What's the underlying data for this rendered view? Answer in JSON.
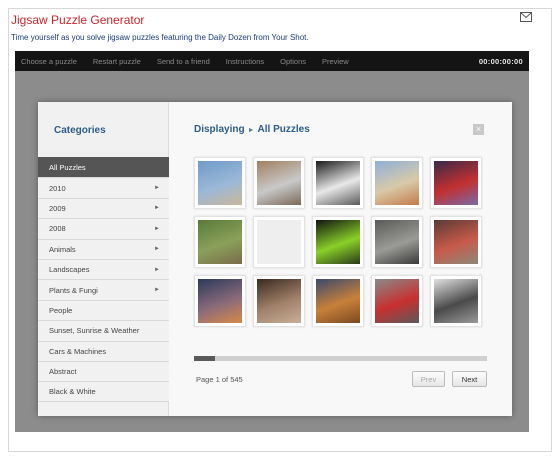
{
  "app": {
    "title": "Jigsaw Puzzle Generator",
    "tagline": "Time yourself as you solve jigsaw puzzles featuring the Daily Dozen from Your Shot.",
    "email_icon": "envelope-icon"
  },
  "toolbar": {
    "items": [
      "Choose a puzzle",
      "Restart puzzle",
      "Send to a friend",
      "Instructions",
      "Options",
      "Preview"
    ],
    "timer": "00:00:00:00"
  },
  "sidebar": {
    "title": "Categories",
    "items": [
      {
        "label": "All Puzzles",
        "has_submenu": false,
        "active": true
      },
      {
        "label": "2010",
        "has_submenu": true
      },
      {
        "label": "2009",
        "has_submenu": true
      },
      {
        "label": "2008",
        "has_submenu": true
      },
      {
        "label": "Animals",
        "has_submenu": true
      },
      {
        "label": "Landscapes",
        "has_submenu": true
      },
      {
        "label": "Plants & Fungi",
        "has_submenu": true
      },
      {
        "label": "People",
        "has_submenu": false
      },
      {
        "label": "Sunset, Sunrise & Weather",
        "has_submenu": false
      },
      {
        "label": "Cars & Machines",
        "has_submenu": false
      },
      {
        "label": "Abstract",
        "has_submenu": false
      },
      {
        "label": "Black & White",
        "has_submenu": false
      }
    ]
  },
  "main": {
    "crumb_prefix": "Displaying",
    "crumb_current": "All Puzzles",
    "close_symbol": "×",
    "page_info": "Page 1 of 545",
    "progress_fraction": 0.07,
    "prev_label": "Prev",
    "next_label": "Next",
    "thumbnails": [
      {
        "name": "thumb-blue-animal",
        "colors": [
          "#6f9ac7",
          "#9bb8d8",
          "#c9b79a"
        ]
      },
      {
        "name": "thumb-metal-sculpture",
        "colors": [
          "#a08060",
          "#c9c9c9",
          "#7a6a58"
        ]
      },
      {
        "name": "thumb-arch-bw",
        "colors": [
          "#1a1a1a",
          "#e8e8e8",
          "#5a5a5a"
        ]
      },
      {
        "name": "thumb-sky-sculpture",
        "colors": [
          "#8fb0da",
          "#d8c9a8",
          "#c47a4a"
        ]
      },
      {
        "name": "thumb-red-lights",
        "colors": [
          "#3a2a4a",
          "#c23030",
          "#7a6aa8"
        ]
      },
      {
        "name": "thumb-green-animals",
        "colors": [
          "#5a7a3a",
          "#8aa05a",
          "#7a6a4a"
        ]
      },
      {
        "name": "thumb-blank",
        "colors": [
          "#eeeeee",
          "#eeeeee",
          "#eeeeee"
        ]
      },
      {
        "name": "thumb-green-leaf",
        "colors": [
          "#101410",
          "#8ad028",
          "#2a3a1a"
        ]
      },
      {
        "name": "thumb-rocky-creature",
        "colors": [
          "#5a5a58",
          "#9a9a96",
          "#3a3a3a"
        ]
      },
      {
        "name": "thumb-red-reptile",
        "colors": [
          "#5a3a34",
          "#c85a4a",
          "#8a8a7a"
        ]
      },
      {
        "name": "thumb-twilight-sky",
        "colors": [
          "#2a3a5a",
          "#8a6a7a",
          "#d88a4a"
        ]
      },
      {
        "name": "thumb-old-man",
        "colors": [
          "#3a2a20",
          "#a08068",
          "#c8b09a"
        ]
      },
      {
        "name": "thumb-desert-field",
        "colors": [
          "#3a4a6a",
          "#c8803a",
          "#7a4a20"
        ]
      },
      {
        "name": "thumb-red-boat",
        "colors": [
          "#8a8a8a",
          "#c83030",
          "#5a5a5a"
        ]
      },
      {
        "name": "thumb-bw-water",
        "colors": [
          "#e0e0e0",
          "#4a4a4a",
          "#9a9a9a"
        ]
      }
    ]
  }
}
